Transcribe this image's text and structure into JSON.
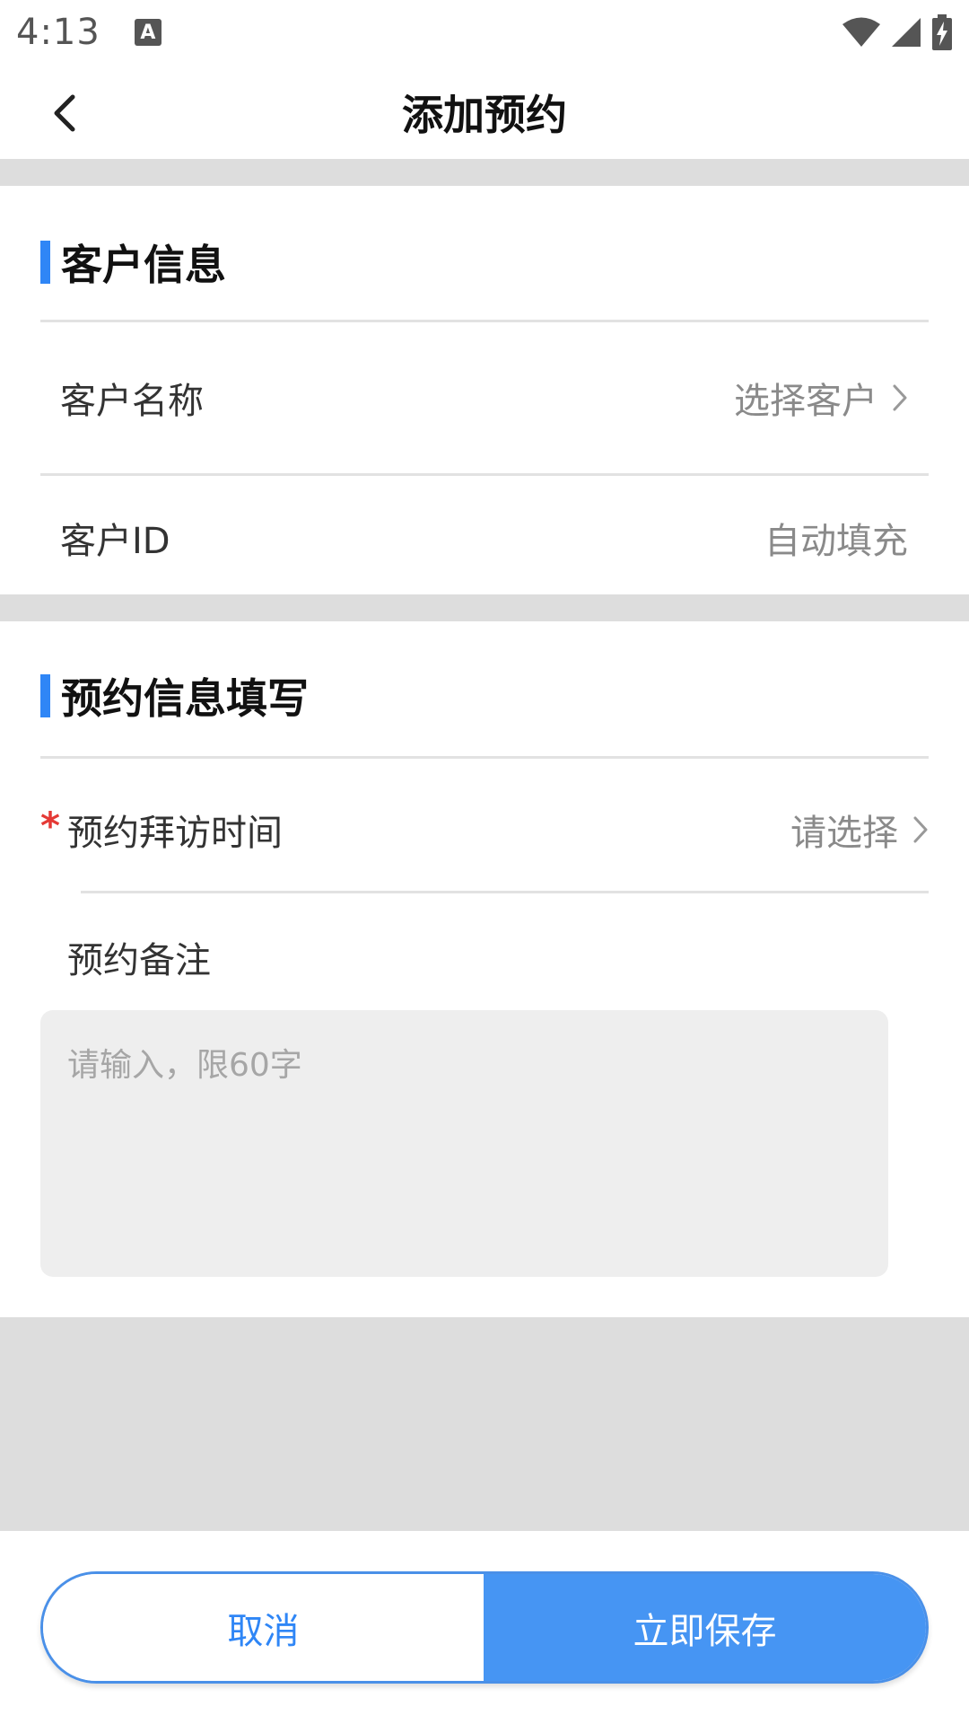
{
  "status_bar": {
    "time": "4:13",
    "notification_icon": "a-icon",
    "icons": [
      "wifi-icon",
      "signal-icon",
      "battery-charging-icon"
    ]
  },
  "nav": {
    "title": "添加预约",
    "back_icon": "chevron-left-icon"
  },
  "customer_section": {
    "title": "客户信息",
    "accent_color": "#2f86f6",
    "rows": [
      {
        "label": "客户名称",
        "value": "选择客户"
      },
      {
        "label": "客户ID",
        "value": "自动填充"
      }
    ]
  },
  "appointment_section": {
    "title": "预约信息填写",
    "visit_time": {
      "required_mark": "*",
      "label": "预约拜访时间",
      "value": "请选择"
    },
    "remark": {
      "label": "预约备注",
      "placeholder": "请输入，限60字"
    }
  },
  "actions": {
    "cancel_label": "取消",
    "save_label": "立即保存",
    "primary_color": "#4695f3"
  }
}
